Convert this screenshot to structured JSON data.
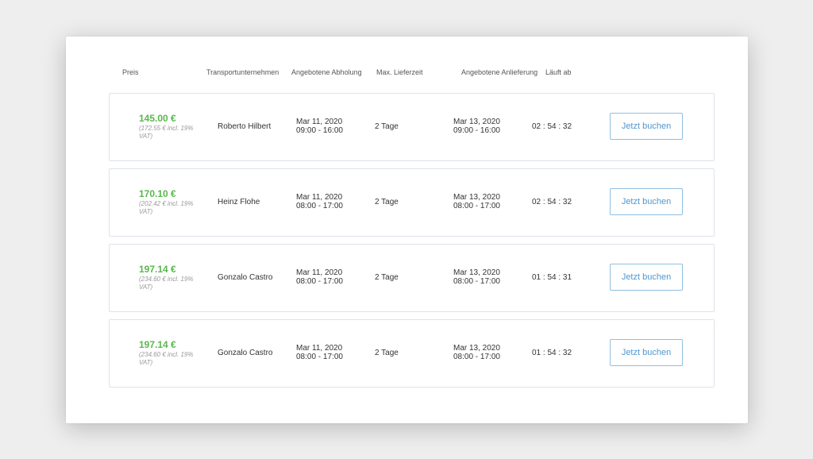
{
  "headers": {
    "price": "Preis",
    "carrier": "Transportunternehmen",
    "pickup": "Angebotene Abholung",
    "max_delivery": "Max. Lieferzeit",
    "delivery": "Angebotene Anlieferung",
    "expires": "Läuft ab"
  },
  "offers": [
    {
      "price": "145.00 €",
      "price_vat": "(172.55 € incl. 19% VAT)",
      "carrier": "Roberto Hilbert",
      "pickup_date": "Mar 11, 2020",
      "pickup_time": "09:00 - 16:00",
      "max_delivery": "2 Tage",
      "delivery_date": "Mar 13, 2020",
      "delivery_time": "09:00 - 16:00",
      "expires": "02 : 54 : 32",
      "button": "Jetzt buchen"
    },
    {
      "price": "170.10 €",
      "price_vat": "(202.42 € incl. 19% VAT)",
      "carrier": "Heinz Flohe",
      "pickup_date": "Mar 11, 2020",
      "pickup_time": "08:00 - 17:00",
      "max_delivery": "2 Tage",
      "delivery_date": "Mar 13, 2020",
      "delivery_time": "08:00 - 17:00",
      "expires": "02 : 54 : 32",
      "button": "Jetzt buchen"
    },
    {
      "price": "197.14 €",
      "price_vat": "(234.60 € incl. 19% VAT)",
      "carrier": "Gonzalo Castro",
      "pickup_date": "Mar 11, 2020",
      "pickup_time": "08:00 - 17:00",
      "max_delivery": "2 Tage",
      "delivery_date": "Mar 13, 2020",
      "delivery_time": "08:00 - 17:00",
      "expires": "01 : 54 : 31",
      "button": "Jetzt buchen"
    },
    {
      "price": "197.14 €",
      "price_vat": "(234.60 € incl. 19% VAT)",
      "carrier": "Gonzalo Castro",
      "pickup_date": "Mar 11, 2020",
      "pickup_time": "08:00 - 17:00",
      "max_delivery": "2 Tage",
      "delivery_date": "Mar 13, 2020",
      "delivery_time": "08:00 - 17:00",
      "expires": "01 : 54 : 32",
      "button": "Jetzt buchen"
    }
  ],
  "colors": {
    "price": "#58b84c",
    "button_text": "#4f97cf",
    "button_border": "#8fbfe0",
    "row_border": "#dde3ea",
    "background": "#eeeeee"
  }
}
